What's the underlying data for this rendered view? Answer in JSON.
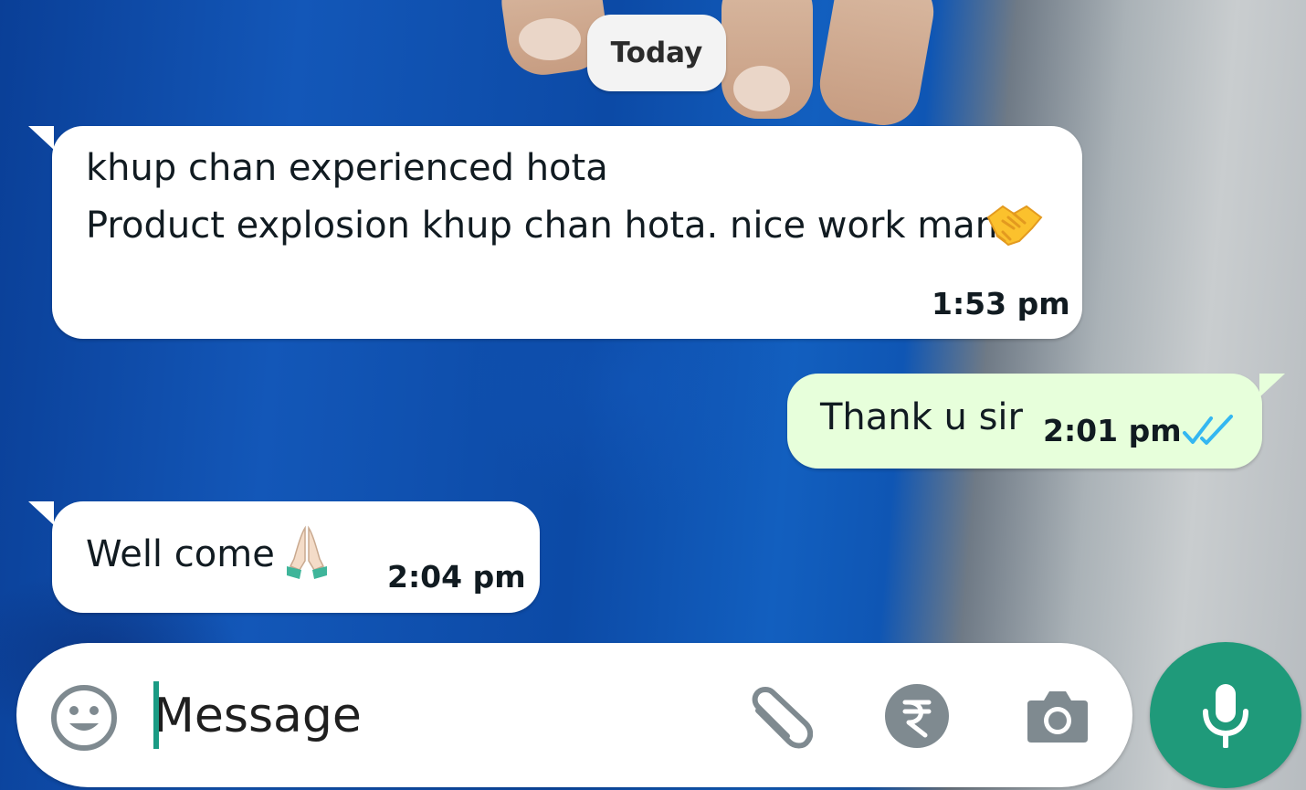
{
  "date_separator": "Today",
  "messages": [
    {
      "direction": "incoming",
      "lines": [
        "khup chan experienced hota",
        "Product explosion khup chan hota. nice work mam"
      ],
      "emoji": "handshake-emoji",
      "time": "1:53 pm"
    },
    {
      "direction": "outgoing",
      "text": "Thank u sir",
      "time": "2:01 pm",
      "status": "read-double-tick"
    },
    {
      "direction": "incoming",
      "text": "Well come",
      "emoji": "folded-hands-emoji",
      "time": "2:04 pm"
    }
  ],
  "composer": {
    "placeholder": "Message",
    "icons": [
      "emoji-icon",
      "attach-icon",
      "rupee-payment-icon",
      "camera-icon",
      "mic-icon"
    ]
  },
  "colors": {
    "incoming_bubble": "#ffffff",
    "outgoing_bubble": "#e7ffdb",
    "read_tick": "#34b7f1",
    "mic_button": "#1f9a7a",
    "composer_icon": "#7f8a90",
    "caret": "#1a9b84"
  }
}
